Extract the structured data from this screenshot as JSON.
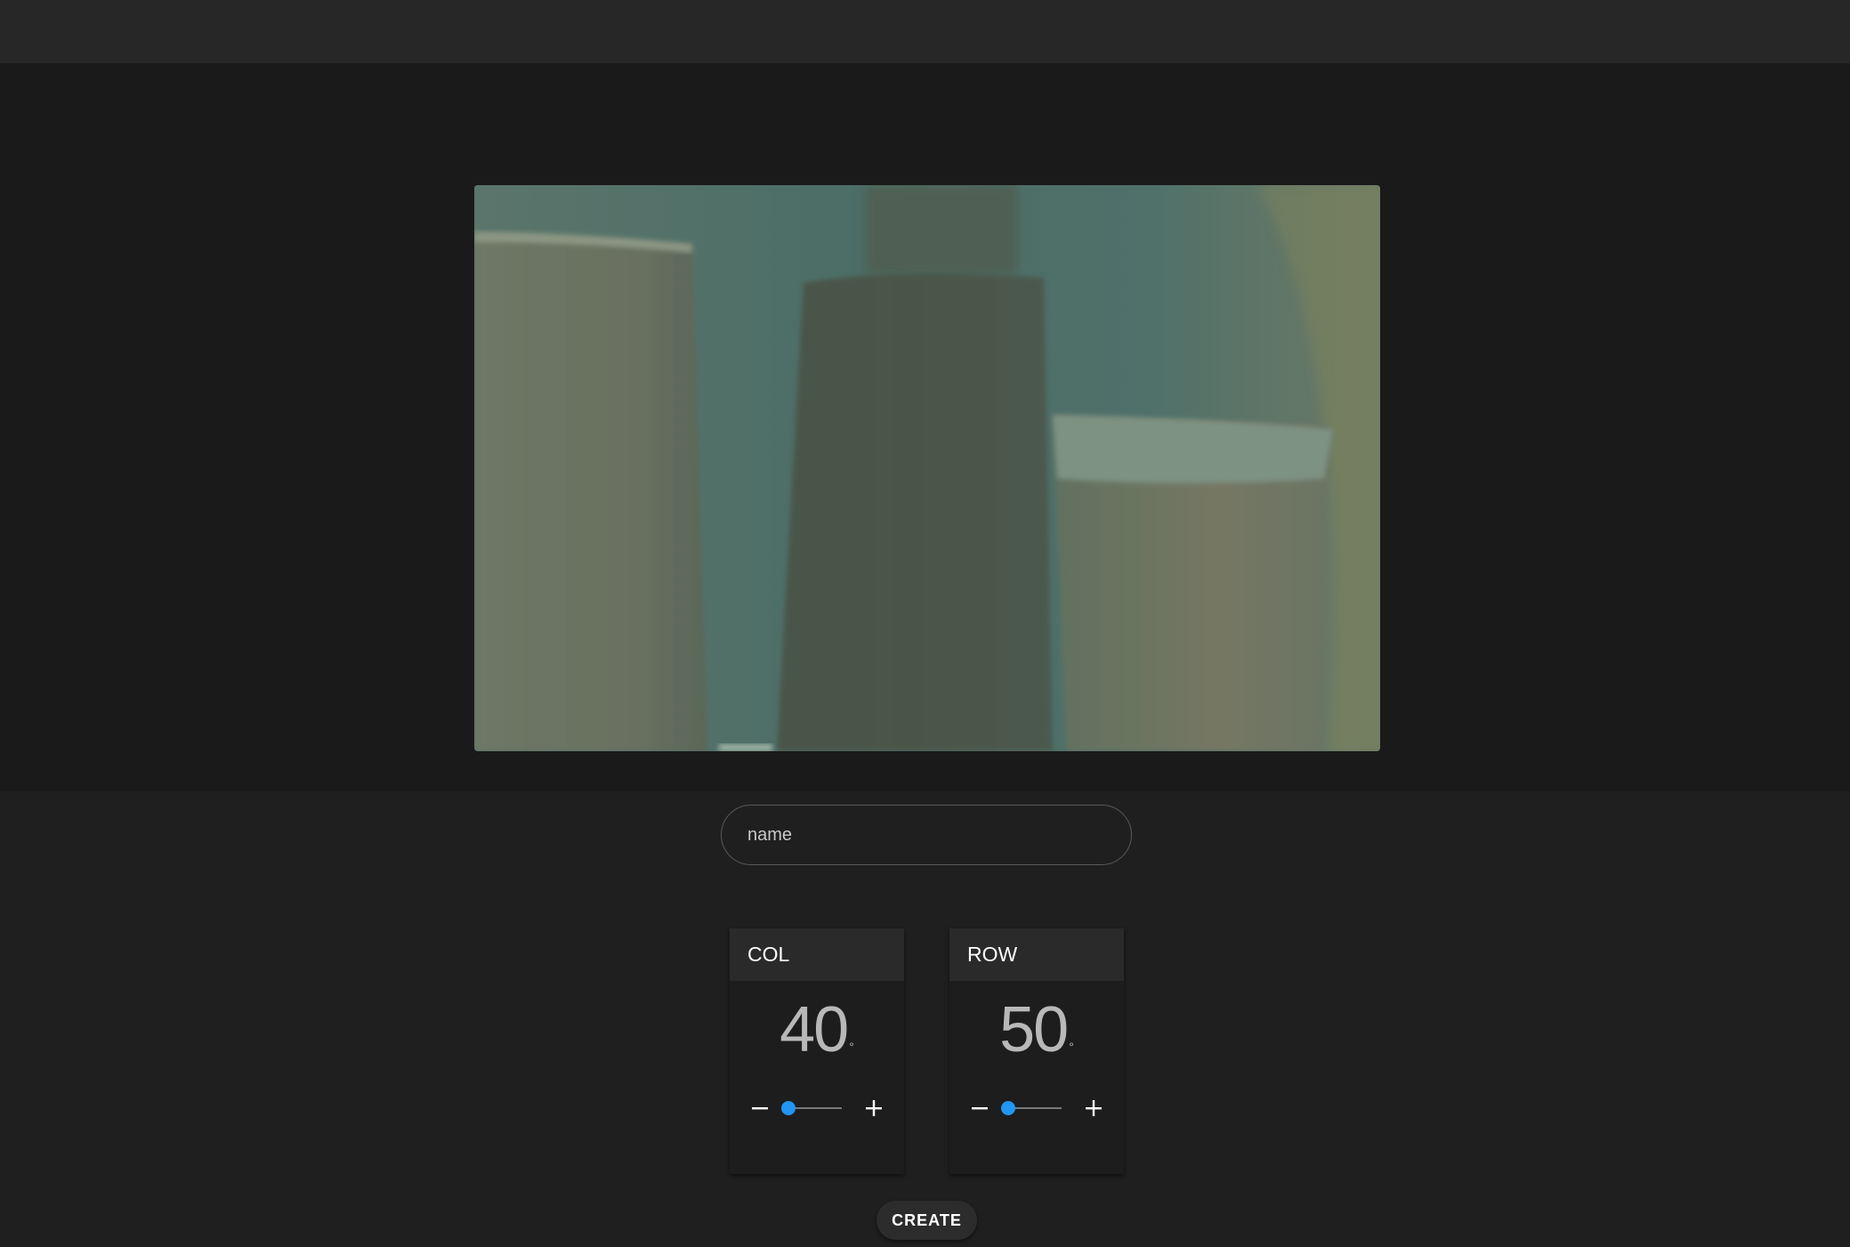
{
  "name_input": {
    "placeholder": "name",
    "value": ""
  },
  "col_control": {
    "label": "COL",
    "value": "40",
    "unit": "°",
    "slider_level": 0.03,
    "minus_icon": "minus-icon",
    "plus_icon": "plus-icon"
  },
  "row_control": {
    "label": "ROW",
    "value": "50",
    "unit": "°",
    "slider_level": 0.03,
    "minus_icon": "minus-icon",
    "plus_icon": "plus-icon"
  },
  "create_button": {
    "label": "CREATE"
  },
  "colors": {
    "accent": "#2196f3",
    "background": "#1f1f1f",
    "topbar": "#272727"
  }
}
